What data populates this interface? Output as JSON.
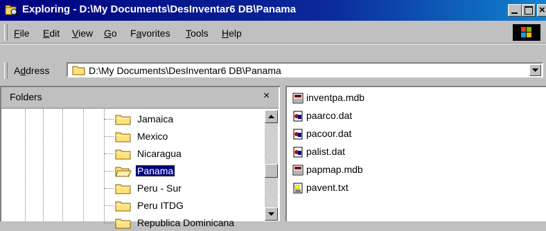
{
  "window": {
    "title": "Exploring - D:\\My Documents\\DesInventar6 DB\\Panama"
  },
  "menu": {
    "items": [
      {
        "pre": "",
        "key": "F",
        "post": "ile"
      },
      {
        "pre": "",
        "key": "E",
        "post": "dit"
      },
      {
        "pre": "",
        "key": "V",
        "post": "iew"
      },
      {
        "pre": "",
        "key": "G",
        "post": "o"
      },
      {
        "pre": "F",
        "key": "a",
        "post": "vorites"
      },
      {
        "pre": "",
        "key": "T",
        "post": "ools"
      },
      {
        "pre": "",
        "key": "H",
        "post": "elp"
      }
    ]
  },
  "address": {
    "label_pre": "A",
    "label_key": "d",
    "label_post": "dress",
    "value": "D:\\My Documents\\DesInventar6 DB\\Panama"
  },
  "folders": {
    "title": "Folders",
    "close": "×",
    "items": [
      {
        "label": "Jamaica",
        "selected": false
      },
      {
        "label": "Mexico",
        "selected": false
      },
      {
        "label": "Nicaragua",
        "selected": false
      },
      {
        "label": "Panama",
        "selected": true
      },
      {
        "label": "Peru - Sur",
        "selected": false
      },
      {
        "label": "Peru ITDG",
        "selected": false
      },
      {
        "label": "Republica Dominicana",
        "selected": false
      }
    ]
  },
  "files": {
    "items": [
      {
        "name": "inventpa.mdb",
        "icon": "access-db-icon"
      },
      {
        "name": "paarco.dat",
        "icon": "data-file-icon"
      },
      {
        "name": "pacoor.dat",
        "icon": "data-file-icon"
      },
      {
        "name": "palist.dat",
        "icon": "data-file-icon"
      },
      {
        "name": "papmap.mdb",
        "icon": "access-db-icon"
      },
      {
        "name": "pavent.txt",
        "icon": "text-file-icon"
      }
    ]
  },
  "colors": {
    "title_bar": "#000080",
    "selection": "#000080",
    "face": "#c0c0c0"
  }
}
